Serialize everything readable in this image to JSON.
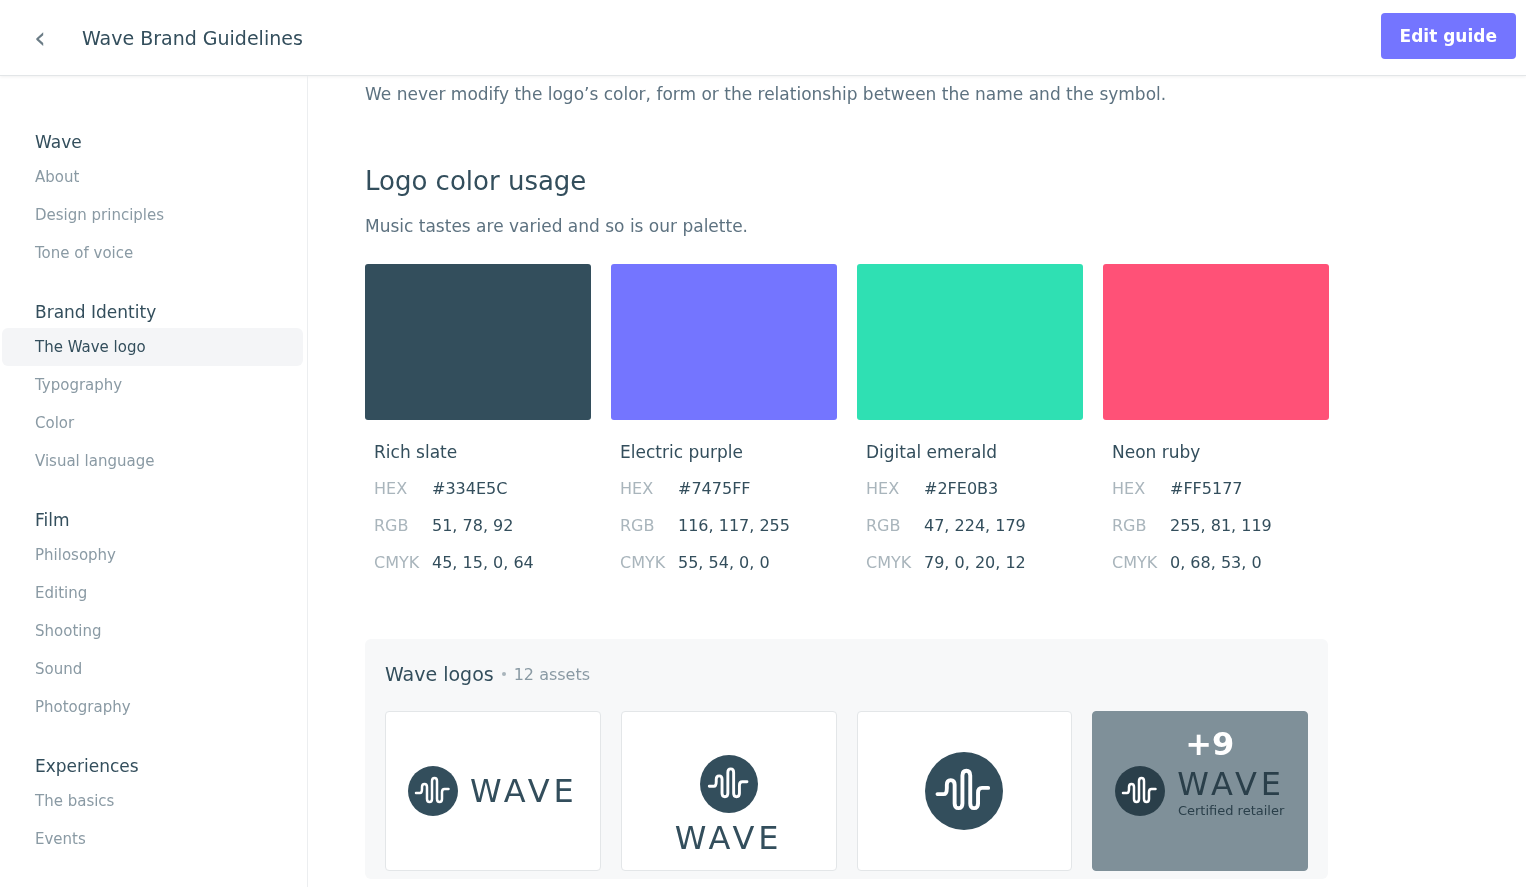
{
  "header": {
    "back_icon": "‹",
    "title": "Wave Brand Guidelines",
    "action": "Edit guide"
  },
  "sidebar": {
    "sections": [
      {
        "title": "Wave",
        "items": [
          {
            "label": "About",
            "selected": false
          },
          {
            "label": "Design principles",
            "selected": false
          },
          {
            "label": "Tone of voice",
            "selected": false
          }
        ]
      },
      {
        "title": "Brand Identity",
        "items": [
          {
            "label": "The Wave logo",
            "selected": true
          },
          {
            "label": "Typography",
            "selected": false
          },
          {
            "label": "Color",
            "selected": false
          },
          {
            "label": "Visual language",
            "selected": false
          }
        ]
      },
      {
        "title": "Film",
        "items": [
          {
            "label": "Philosophy",
            "selected": false
          },
          {
            "label": "Editing",
            "selected": false
          },
          {
            "label": "Shooting",
            "selected": false
          },
          {
            "label": "Sound",
            "selected": false
          },
          {
            "label": "Photography",
            "selected": false
          }
        ]
      },
      {
        "title": "Experiences",
        "items": [
          {
            "label": "The basics",
            "selected": false
          },
          {
            "label": "Events",
            "selected": false
          }
        ]
      }
    ]
  },
  "intro": "We never modify the logo’s color, form or the relationship between the name and the symbol.",
  "section": {
    "title": "Logo color usage",
    "subtitle": "Music tastes are varied and so is our palette."
  },
  "colors": [
    {
      "name": "Rich slate",
      "color": "#334e5c",
      "values": [
        {
          "label": "HEX",
          "value": "#334E5C"
        },
        {
          "label": "RGB",
          "value": "51, 78, 92"
        },
        {
          "label": "CMYK",
          "value": "45, 15, 0, 64"
        }
      ]
    },
    {
      "name": "Electric purple",
      "color": "#7475ff",
      "values": [
        {
          "label": "HEX",
          "value": "#7475FF"
        },
        {
          "label": "RGB",
          "value": "116, 117, 255"
        },
        {
          "label": "CMYK",
          "value": "55, 54, 0, 0"
        }
      ]
    },
    {
      "name": "Digital emerald",
      "color": "#2fe0b3",
      "values": [
        {
          "label": "HEX",
          "value": "#2FE0B3"
        },
        {
          "label": "RGB",
          "value": "47, 224, 179"
        },
        {
          "label": "CMYK",
          "value": "79, 0, 20, 12"
        }
      ]
    },
    {
      "name": "Neon ruby",
      "color": "#ff5177",
      "values": [
        {
          "label": "HEX",
          "value": "#FF5177"
        },
        {
          "label": "RGB",
          "value": "255, 81, 119"
        },
        {
          "label": "CMYK",
          "value": "0, 68, 53, 0"
        }
      ]
    }
  ],
  "assets": {
    "title": "Wave logos",
    "count": "12 assets",
    "items": [
      {
        "kind": "horizontal",
        "wordmark": "WAVE"
      },
      {
        "kind": "stacked",
        "wordmark": "WAVE"
      },
      {
        "kind": "symbol"
      },
      {
        "kind": "more",
        "wordmark": "WAVE",
        "caption": "Certified retailer",
        "more": "+9"
      }
    ]
  }
}
